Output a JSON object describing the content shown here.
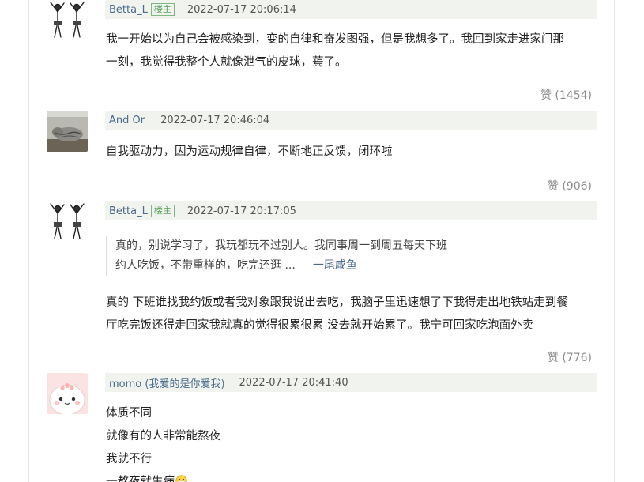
{
  "posts": [
    {
      "username": "Betta_L",
      "badge": "楼主",
      "time": "2022-07-17 20:06:14",
      "lines": [
        "我一开始以为自己会被感染到，变的自律和奋发图强，但是我想多了。我回到家走进家门那",
        "一刻，我觉得我整个人就像泄气的皮球，蔫了。"
      ],
      "like": "赞 (1454)"
    },
    {
      "username": "And Or",
      "time": "2022-07-17 20:46:04",
      "lines": [
        "自我驱动力，因为运动规律自律，不断地正反馈，闭环啦"
      ],
      "like": "赞 (906)"
    },
    {
      "username": "Betta_L",
      "badge": "楼主",
      "time": "2022-07-17 20:17:05",
      "quote_line1": "真的，别说学习了，我玩都玩不过别人。我同事周一到周五每天下班",
      "quote_line2": "约人吃饭，不带重样的，吃完还逛 ...",
      "quote_author": "一尾咸鱼",
      "lines": [
        "真的 下班谁找我约饭或者我对象跟我说出去吃，我脑子里迅速想了下我得走出地铁站走到餐",
        "厅吃完饭还得走回家我就真的觉得很累很累 没去就开始累了。我宁可回家吃泡面外卖"
      ],
      "like": "赞 (776)"
    },
    {
      "username": "momo (我爱的是你爱我)",
      "time": "2022-07-17 20:41:40",
      "lines": [
        "体质不同",
        "就像有的人非常能熬夜",
        "我就不行",
        "一熬夜就生病"
      ],
      "emoji": "sick-face-emoji"
    }
  ],
  "colors": {
    "meta_bg": "#f1f3ef",
    "badge_green": "#5aa05a",
    "username_blue": "#4a6b8a",
    "like_gray": "#8a8a8a"
  }
}
